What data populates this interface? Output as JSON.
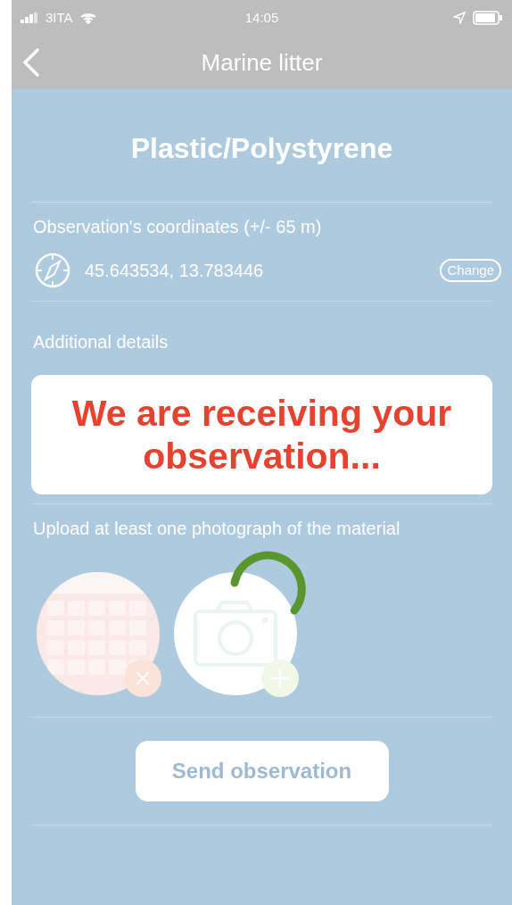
{
  "status_bar": {
    "carrier": "3ITA",
    "time": "14:05"
  },
  "nav": {
    "title": "Marine litter"
  },
  "heading": "Plastic/Polystyrene",
  "coordinates": {
    "label": "Observation's coordinates (+/- 65 m)",
    "value": "45.643534, 13.783446",
    "button": "Change"
  },
  "details": {
    "label": "Additional details"
  },
  "loading": {
    "message": "We are receiving your observation..."
  },
  "photos": {
    "label": "Upload at least one photograph of the material",
    "items": [
      {
        "kind": "picture"
      },
      {
        "kind": "add"
      }
    ]
  },
  "send_button": "Send observation"
}
